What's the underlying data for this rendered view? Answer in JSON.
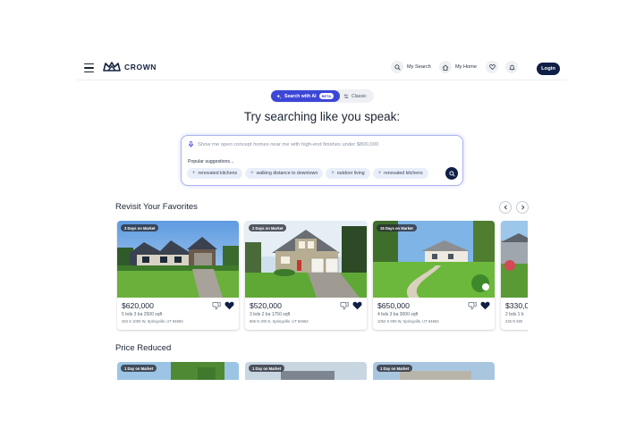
{
  "brand": {
    "name": "CROWN",
    "navy": "#0f1f45",
    "accent": "#3c46d6"
  },
  "header": {
    "menu_icon": "hamburger-icon",
    "my_search_label": "My Search",
    "my_home_label": "My Home",
    "favorites_icon": "heart-icon",
    "notifications_icon": "bell-icon",
    "login_label": "Login"
  },
  "mode_toggle": {
    "ai_label": "Search with AI",
    "beta_label": "BETA",
    "classic_label": "Classic"
  },
  "hero": {
    "title": "Try searching like you speak:"
  },
  "search": {
    "placeholder": "Show me open concept homes near me with high-end finishes under $800,000",
    "suggestions_label": "Popular suggestions...",
    "suggestions": [
      "renovated kitchens",
      "walking distance to downtown",
      "outdoor living",
      "renovated kitchens"
    ]
  },
  "favorites": {
    "title": "Revisit Your Favorites",
    "listings": [
      {
        "badge": "3 Days on Market",
        "price": "$620,000",
        "specs": "5 bds  3 ba  2500 sqft",
        "address": "453 S 1000 W, Springville, UT 84663"
      },
      {
        "badge": "2 Days on Market",
        "price": "$520,000",
        "specs": "3 bds  2 ba  1750 sqft",
        "address": "865 N 200 E, Springville, UT 84663"
      },
      {
        "badge": "15 Days on Market",
        "price": "$650,000",
        "specs": "4 bds  3 ba  3000 sqft",
        "address": "1052 S 900 W, Springville, UT 84663"
      },
      {
        "badge": "",
        "price": "$330,0",
        "specs": "2 bds  1 b",
        "address": "225 N 500"
      }
    ]
  },
  "price_reduced": {
    "title": "Price Reduced",
    "badges": [
      "1 Day on Market",
      "1 Day on Market",
      "1 Day on Market"
    ]
  }
}
